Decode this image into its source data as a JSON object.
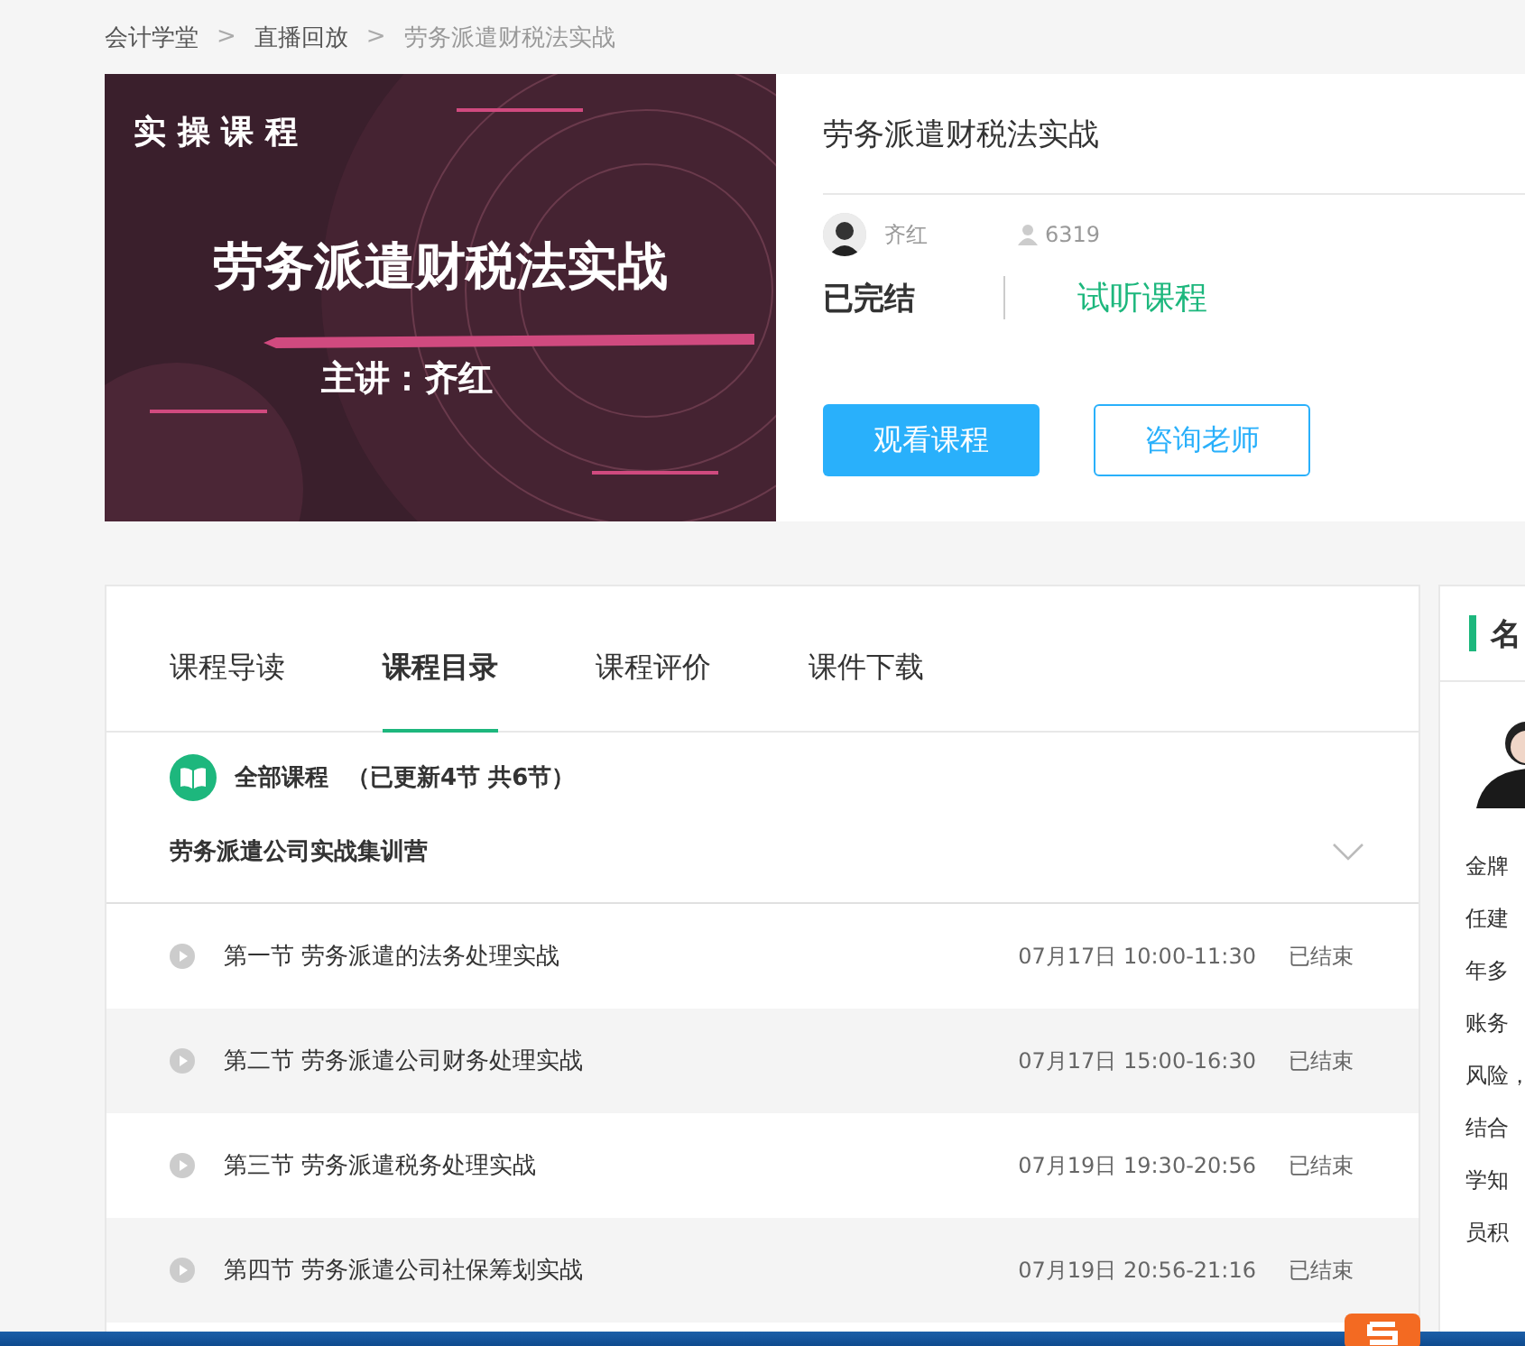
{
  "breadcrumb": {
    "separator": ">",
    "items": [
      {
        "label": "会计学堂",
        "current": false
      },
      {
        "label": "直播回放",
        "current": false
      },
      {
        "label": "劳务派遣财税法实战",
        "current": true
      }
    ]
  },
  "course": {
    "cover": {
      "tag": "实 操 课 程",
      "title": "劳务派遣财税法实战",
      "lecturer": "主讲：齐红"
    },
    "title": "劳务派遣财税法实战",
    "teacher": "齐红",
    "students": "6319",
    "status": "已完结",
    "trial_link": "试听课程",
    "buttons": [
      {
        "label": "观看课程",
        "kind": "primary"
      },
      {
        "label": "咨询老师",
        "kind": "outline"
      }
    ]
  },
  "catalog": {
    "tabs": [
      {
        "label": "课程导读",
        "selected": false
      },
      {
        "label": "课程目录",
        "selected": true
      },
      {
        "label": "课程评价",
        "selected": false
      },
      {
        "label": "课件下载",
        "selected": false
      }
    ],
    "summary": {
      "label": "全部课程",
      "count": "（已更新4节 共6节）"
    },
    "group_title": "劳务派遣公司实战集训营",
    "lessons": [
      {
        "title": "第一节 劳务派遣的法务处理实战",
        "time": "07月17日 10:00-11:30",
        "status": "已结束"
      },
      {
        "title": "第二节 劳务派遣公司财务处理实战",
        "time": "07月17日 15:00-16:30",
        "status": "已结束"
      },
      {
        "title": "第三节 劳务派遣税务处理实战",
        "time": "07月19日 19:30-20:56",
        "status": "已结束"
      },
      {
        "title": "第四节 劳务派遣公司社保筹划实战",
        "time": "07月19日 20:56-21:16",
        "status": "已结束"
      }
    ]
  },
  "sidebar": {
    "heading": "名",
    "lines": [
      "金牌",
      "任建",
      "年多",
      "账务",
      "风险，",
      "结合",
      "学知",
      "员积"
    ]
  }
}
